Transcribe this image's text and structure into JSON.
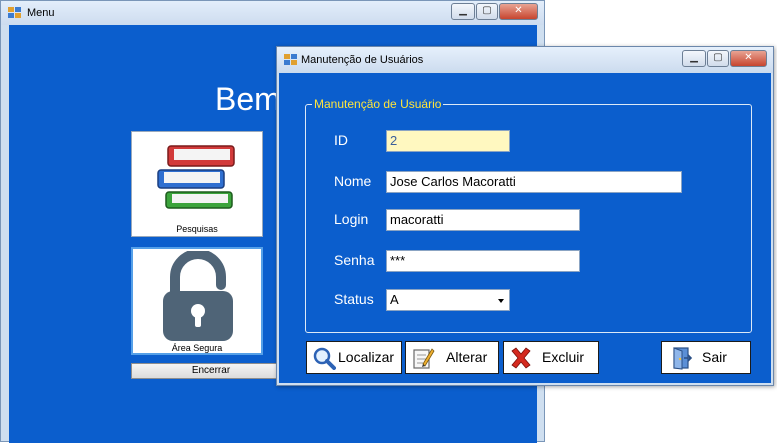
{
  "menu_window": {
    "title": "Menu",
    "welcome_text": "Bem",
    "tiles": [
      {
        "label": "Pesquisas",
        "icon": "books-icon"
      },
      {
        "label": "Área Segura",
        "icon": "padlock-icon"
      }
    ],
    "encerrar_label": "Encerrar"
  },
  "dialog": {
    "title": "Manutenção de Usuários",
    "group_title": "Manutenção de Usuário",
    "fields": {
      "id": {
        "label": "ID",
        "value": "2"
      },
      "nome": {
        "label": "Nome",
        "value": "Jose Carlos Macoratti"
      },
      "login": {
        "label": "Login",
        "value": "macoratti"
      },
      "senha": {
        "label": "Senha",
        "value": "***"
      },
      "status": {
        "label": "Status",
        "value": "A"
      }
    },
    "buttons": {
      "localizar": "Localizar",
      "alterar": "Alterar",
      "excluir": "Excluir",
      "sair": "Sair"
    }
  },
  "window_controls": {
    "minimize": "▁",
    "maximize": "▢",
    "close": "✕"
  },
  "colors": {
    "client_blue": "#0b5ecd",
    "group_title_yellow": "#ffe53b",
    "readonly_field": "#fff8c0",
    "close_red": "#c7452f"
  }
}
